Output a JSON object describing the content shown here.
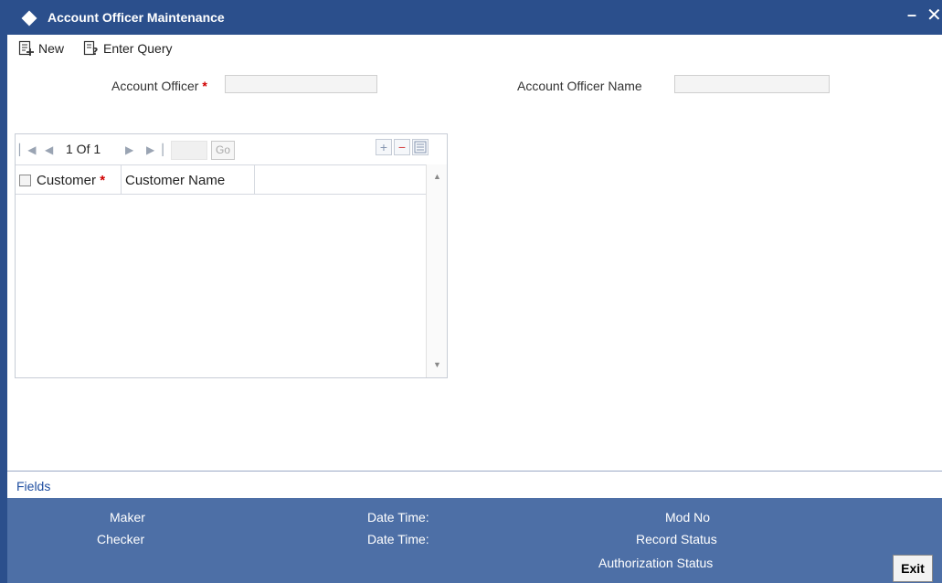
{
  "window": {
    "title": "Account Officer Maintenance",
    "minimize": "–",
    "close": "✕"
  },
  "toolbar": {
    "new_label": "New",
    "enter_query_label": "Enter Query"
  },
  "form": {
    "account_officer_label": "Account Officer",
    "account_officer_required": "*",
    "account_officer_value": "",
    "account_officer_name_label": "Account Officer Name",
    "account_officer_name_value": ""
  },
  "grid": {
    "page_info": "1 Of 1",
    "go_label": "Go",
    "add_symbol": "+",
    "remove_symbol": "−",
    "columns": [
      {
        "label": "Customer",
        "required": "*"
      },
      {
        "label": "Customer Name"
      }
    ],
    "rows": []
  },
  "fields_link": "Fields",
  "footer": {
    "maker": "Maker",
    "checker": "Checker",
    "date_time_1": "Date Time:",
    "date_time_2": "Date Time:",
    "mod_no": "Mod No",
    "record_status": "Record Status",
    "authorization_status": "Authorization Status",
    "exit_label": "Exit"
  },
  "colors": {
    "titlebar": "#2b4f8c",
    "footer": "#4d6fa6",
    "required": "#d00000",
    "link": "#1f4ea0"
  }
}
